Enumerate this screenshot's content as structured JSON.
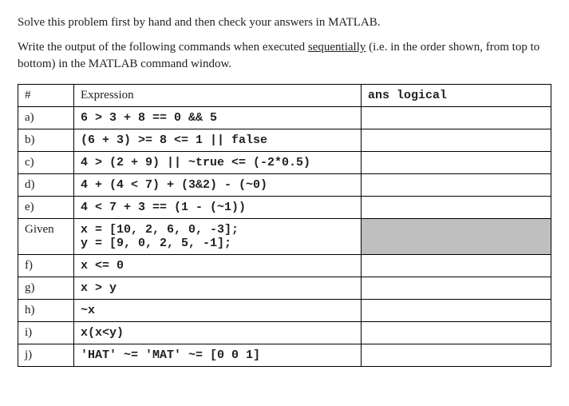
{
  "intro": {
    "line1": "Solve this problem first by hand and then check your answers in MATLAB.",
    "line2_a": "Write the output of the following commands when executed ",
    "line2_u": "sequentially",
    "line2_b": " (i.e. in the order shown, from top to bottom) in the MATLAB command window."
  },
  "headers": {
    "hash": "#",
    "expression": "Expression",
    "ans_prefix": "ans ",
    "ans_code": "logical"
  },
  "rows": {
    "a": {
      "label": "a)",
      "expr": "6 > 3 + 8 == 0 && 5"
    },
    "b": {
      "label": "b)",
      "expr": "(6 + 3) >= 8 <= 1 || false"
    },
    "c": {
      "label": "c)",
      "expr": "4 > (2 + 9) || ~true <= (-2*0.5)"
    },
    "d": {
      "label": "d)",
      "expr": "4 + (4 < 7) + (3&2) - (~0)"
    },
    "e": {
      "label": "e)",
      "expr": "4 < 7 + 3 == (1 - (~1))"
    },
    "given": {
      "label": "Given",
      "expr": "x = [10, 2, 6, 0, -3];\ny = [9, 0, 2, 5, -1];"
    },
    "f": {
      "label": "f)",
      "expr": "x <= 0"
    },
    "g": {
      "label": "g)",
      "expr": "x > y"
    },
    "h": {
      "label": "h)",
      "expr": "~x"
    },
    "i": {
      "label": "i)",
      "expr": "x(x<y)"
    },
    "j": {
      "label": "j)",
      "expr": "'HAT' ~= 'MAT' ~= [0 0 1]"
    }
  }
}
